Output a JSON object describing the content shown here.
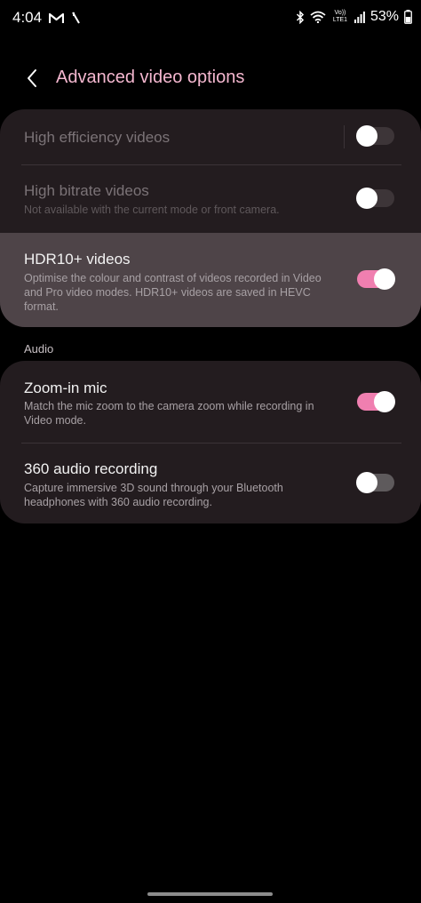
{
  "status_bar": {
    "time": "4:04",
    "volte_line1": "Vo))",
    "volte_line2": "LTE1",
    "battery_percent": "53%",
    "icons": [
      "gmail-icon",
      "signal-off-icon",
      "bluetooth-icon",
      "wifi-icon",
      "volte-icon",
      "cellular-signal-icon",
      "battery-icon"
    ]
  },
  "header": {
    "title": "Advanced video options",
    "back_icon": "chevron-left-icon"
  },
  "video_settings": [
    {
      "title": "High efficiency videos",
      "description": "",
      "enabled": false,
      "checked": false
    },
    {
      "title": "High bitrate videos",
      "description": "Not available with the current mode or front camera.",
      "enabled": false,
      "checked": false
    },
    {
      "title": "HDR10+ videos",
      "description": "Optimise the colour and contrast of videos recorded in Video and Pro video modes. HDR10+ videos are saved in HEVC format.",
      "enabled": true,
      "checked": true
    }
  ],
  "audio_section": {
    "label": "Audio",
    "items": [
      {
        "title": "Zoom-in mic",
        "description": "Match the mic zoom to the camera zoom while recording in Video mode.",
        "enabled": true,
        "checked": true
      },
      {
        "title": "360 audio recording",
        "description": "Capture immersive 3D sound through your Bluetooth headphones with 360 audio recording.",
        "enabled": true,
        "checked": false
      }
    ]
  },
  "colors": {
    "accent": "#f07fb0",
    "title_pink": "#f4b7cf",
    "card_bg": "#231c1f",
    "highlight_bg": "#4e4448"
  }
}
